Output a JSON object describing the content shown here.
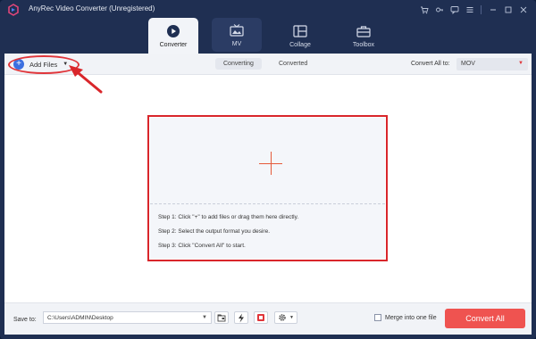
{
  "window": {
    "title": "AnyRec Video Converter (Unregistered)"
  },
  "titlebar_icons": [
    "cart-icon",
    "key-icon",
    "feedback-icon",
    "menu-icon",
    "minimize-icon",
    "maximize-icon",
    "close-icon"
  ],
  "tabs": [
    {
      "label": "Converter",
      "icon": "converter-icon",
      "active": true
    },
    {
      "label": "MV",
      "icon": "mv-icon",
      "active": false
    },
    {
      "label": "Collage",
      "icon": "collage-icon",
      "active": false
    },
    {
      "label": "Toolbox",
      "icon": "toolbox-icon",
      "active": false
    }
  ],
  "toolbar": {
    "add_files_label": "Add Files",
    "segments": [
      "Converting",
      "Converted"
    ],
    "convert_all_to_label": "Convert All to:",
    "format_value": "MOV"
  },
  "dropzone": {
    "steps": [
      "Step 1: Click \"+\" to add files or drag them here directly.",
      "Step 2: Select the output format you desire.",
      "Step 3: Click \"Convert All\" to start."
    ]
  },
  "bottombar": {
    "save_to_label": "Save to:",
    "path_value": "C:\\Users\\ADMIN\\Desktop",
    "merge_label": "Merge into one file",
    "convert_all_label": "Convert All"
  },
  "colors": {
    "window_bg": "#1f2f52",
    "accent_red": "#ef5350",
    "highlight_red": "#d9262b",
    "add_blue": "#3b6fe0"
  }
}
